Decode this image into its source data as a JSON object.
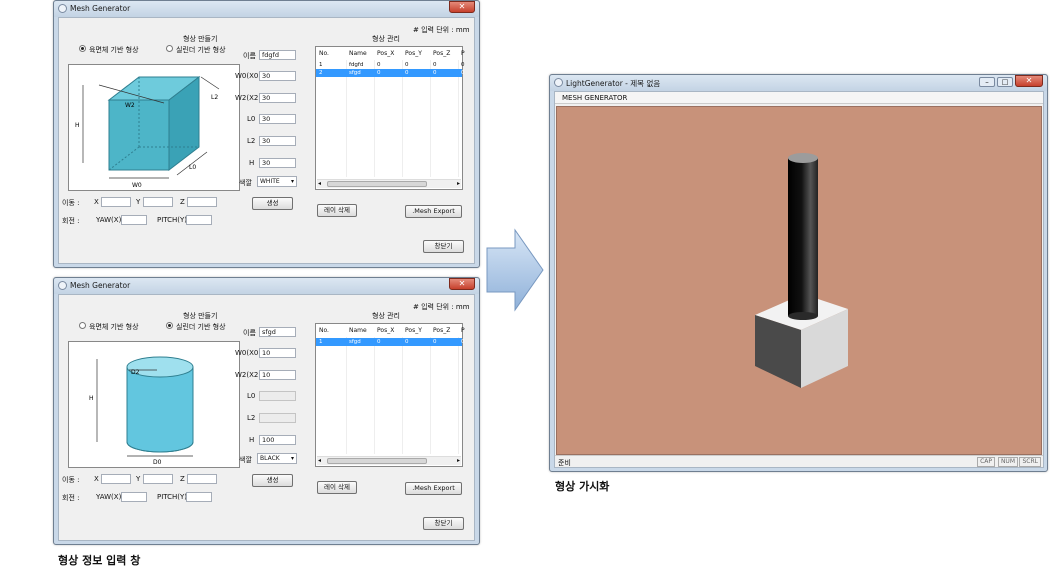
{
  "windows": [
    {
      "title": "Mesh Generator",
      "unit_note": "# 입력 단위 : mm",
      "group_title": "형상 만들기",
      "radio_labels": [
        "육면체 기반 형상",
        "실린더 기반 형상"
      ],
      "selected_radio": 0,
      "field_labels": [
        "이름",
        "W0(X0)",
        "W2(X2)",
        "L0",
        "L2",
        "H",
        "색깔"
      ],
      "field_values": [
        "fdgfd",
        "30",
        "30",
        "30",
        "30",
        "30"
      ],
      "field_disabled": [
        false,
        false,
        false,
        false,
        false,
        false
      ],
      "color_value": "WHITE",
      "create_label": "생성",
      "list_title": "형상 관리",
      "columns": [
        "No.",
        "Name",
        "Pos_X",
        "Pos_Y",
        "Pos_Z",
        "P"
      ],
      "rows": [
        [
          "1",
          "fdgfd",
          "0",
          "0",
          "0",
          "0"
        ],
        [
          "2",
          "sfgd",
          "0",
          "0",
          "0",
          "0"
        ]
      ],
      "selected_row": 1,
      "delete_label": "레이 삭제",
      "export_label": ".Mesh Export",
      "close_label": "창닫기",
      "move_label": "이동 :",
      "move_axes": [
        "X",
        "Y",
        "Z"
      ],
      "rotate_label": "회전 :",
      "rotate_axes": [
        "YAW(X)",
        "PITCH(Y)"
      ],
      "diagram_labels": [
        "W2",
        "L2",
        "H",
        "W0",
        "L0"
      ]
    },
    {
      "title": "Mesh Generator",
      "unit_note": "# 입력 단위 : mm",
      "group_title": "형상 만들기",
      "radio_labels": [
        "육면체 기반 형상",
        "실린더 기반 형상"
      ],
      "selected_radio": 1,
      "field_labels": [
        "이름",
        "W0(X0)",
        "W2(X2)",
        "L0",
        "L2",
        "H",
        "색깔"
      ],
      "field_values": [
        "sfgd",
        "10",
        "10",
        "",
        "",
        "100"
      ],
      "field_disabled": [
        false,
        false,
        false,
        true,
        true,
        false
      ],
      "color_value": "BLACK",
      "create_label": "생성",
      "list_title": "형상 관리",
      "columns": [
        "No.",
        "Name",
        "Pos_X",
        "Pos_Y",
        "Pos_Z",
        "P"
      ],
      "rows": [
        [
          "1",
          "sfgd",
          "0",
          "0",
          "0",
          "0"
        ]
      ],
      "selected_row": 0,
      "delete_label": "레이 삭제",
      "export_label": ".Mesh Export",
      "close_label": "창닫기",
      "move_label": "이동 :",
      "move_axes": [
        "X",
        "Y",
        "Z"
      ],
      "rotate_label": "회전 :",
      "rotate_axes": [
        "YAW(X)",
        "PITCH(Y)"
      ],
      "diagram_labels": [
        "D2",
        "H",
        "D0"
      ]
    }
  ],
  "viewer": {
    "title": "LightGenerator - 제목 없음",
    "menu": "MESH GENERATOR",
    "status": "준비",
    "indicators": [
      "CAP",
      "NUM",
      "SCRL"
    ],
    "bg_color": "#c8927a"
  },
  "captions": {
    "left": "형상 정보 입력 창",
    "right": "형상 가시화"
  }
}
